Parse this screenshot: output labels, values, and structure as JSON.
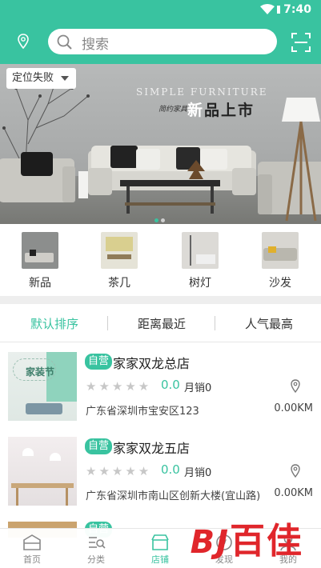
{
  "status_bar": {
    "time": "7:40"
  },
  "header": {
    "search_placeholder": "搜索"
  },
  "banner": {
    "location_label": "定位失败",
    "brand_en": "SIMPLE FURNITURE",
    "brand_cn": "简约家具",
    "headline_new": "新",
    "headline_rest": "品上市"
  },
  "categories": [
    {
      "label": "新品"
    },
    {
      "label": "茶几"
    },
    {
      "label": "树灯"
    },
    {
      "label": "沙发"
    }
  ],
  "sort_tabs": [
    {
      "label": "默认排序",
      "active": true
    },
    {
      "label": "距离最近",
      "active": false
    },
    {
      "label": "人气最高",
      "active": false
    }
  ],
  "shops": [
    {
      "badge": "自营",
      "name": "家家双龙总店",
      "image_text": "家装节",
      "stars": "★★★★★",
      "rating": "0.0",
      "sold": "月销0",
      "address": "广东省深圳市宝安区123",
      "distance": "0.00KM"
    },
    {
      "badge": "自营",
      "name": "家家双龙五店",
      "stars": "★★★★★",
      "rating": "0.0",
      "sold": "月销0",
      "address": "广东省深圳市南山区创新大楼(宜山路)",
      "distance": "0.00KM"
    }
  ],
  "bottom_nav": [
    {
      "label": "首页",
      "icon": "home-icon"
    },
    {
      "label": "分类",
      "icon": "category-icon"
    },
    {
      "label": "店铺",
      "icon": "store-icon",
      "active": true
    },
    {
      "label": "发现",
      "icon": "discover-icon"
    },
    {
      "label": "我的",
      "icon": "user-icon"
    }
  ],
  "watermark": {
    "logo": "BJ",
    "text": "百佳"
  },
  "colors": {
    "accent": "#39c3a0",
    "watermark": "#e0262b"
  }
}
